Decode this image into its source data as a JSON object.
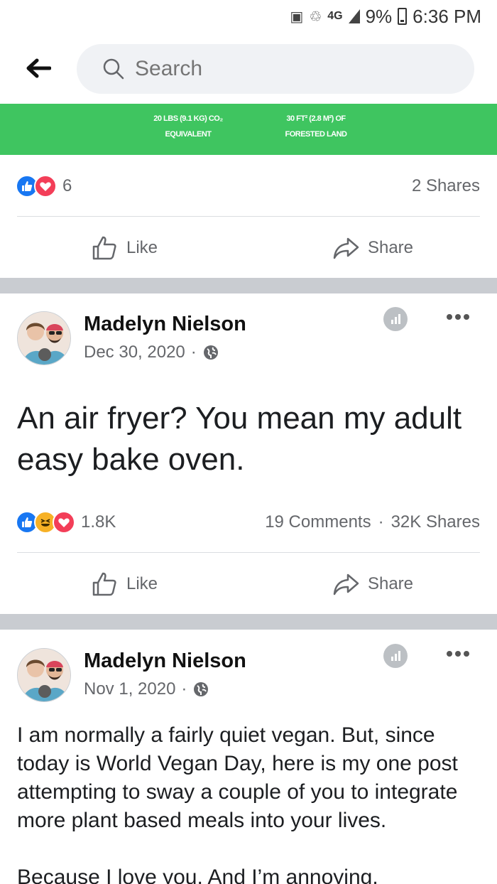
{
  "status_bar": {
    "network": "4G",
    "battery_percent": "9%",
    "time": "6:36 PM"
  },
  "search": {
    "placeholder": "Search"
  },
  "banner": {
    "stat1_line1": "20 LBS (9.1 KG) CO₂",
    "stat1_line2": "EQUIVALENT",
    "stat2_line1": "30 FT² (2.8 M²) OF",
    "stat2_line2": "FORESTED LAND",
    "color": "#3fc560"
  },
  "post0": {
    "reaction_count": "6",
    "shares": "2 Shares",
    "like_label": "Like",
    "share_label": "Share"
  },
  "post1": {
    "author": "Madelyn Nielson",
    "date": "Dec 30, 2020",
    "separator": "·",
    "text": "An air fryer? You mean my adult easy bake oven.",
    "reaction_count": "1.8K",
    "comments": "19 Comments",
    "stats_separator": "·",
    "shares": "32K Shares",
    "like_label": "Like",
    "share_label": "Share"
  },
  "post2": {
    "author": "Madelyn Nielson",
    "date": "Nov 1, 2020",
    "separator": "·",
    "paragraph1": "I am normally a fairly quiet vegan. But, since today is World Vegan Day, here is my one post attempting to sway a couple of you to integrate more plant based meals into your lives.",
    "paragraph2": "Because I love you. And I’m annoying."
  },
  "icons": {
    "back": "back-arrow-icon",
    "search": "search-icon",
    "privacy": "globe-icon",
    "more": "more-options-icon",
    "like": "thumbs-up-icon",
    "share": "share-arrow-icon"
  },
  "colors": {
    "like_blue": "#1877f2",
    "love_red": "#f33e58",
    "haha_yellow": "#f7b125",
    "separator_gray": "#c9ccd1",
    "meta_gray": "#65676b"
  }
}
